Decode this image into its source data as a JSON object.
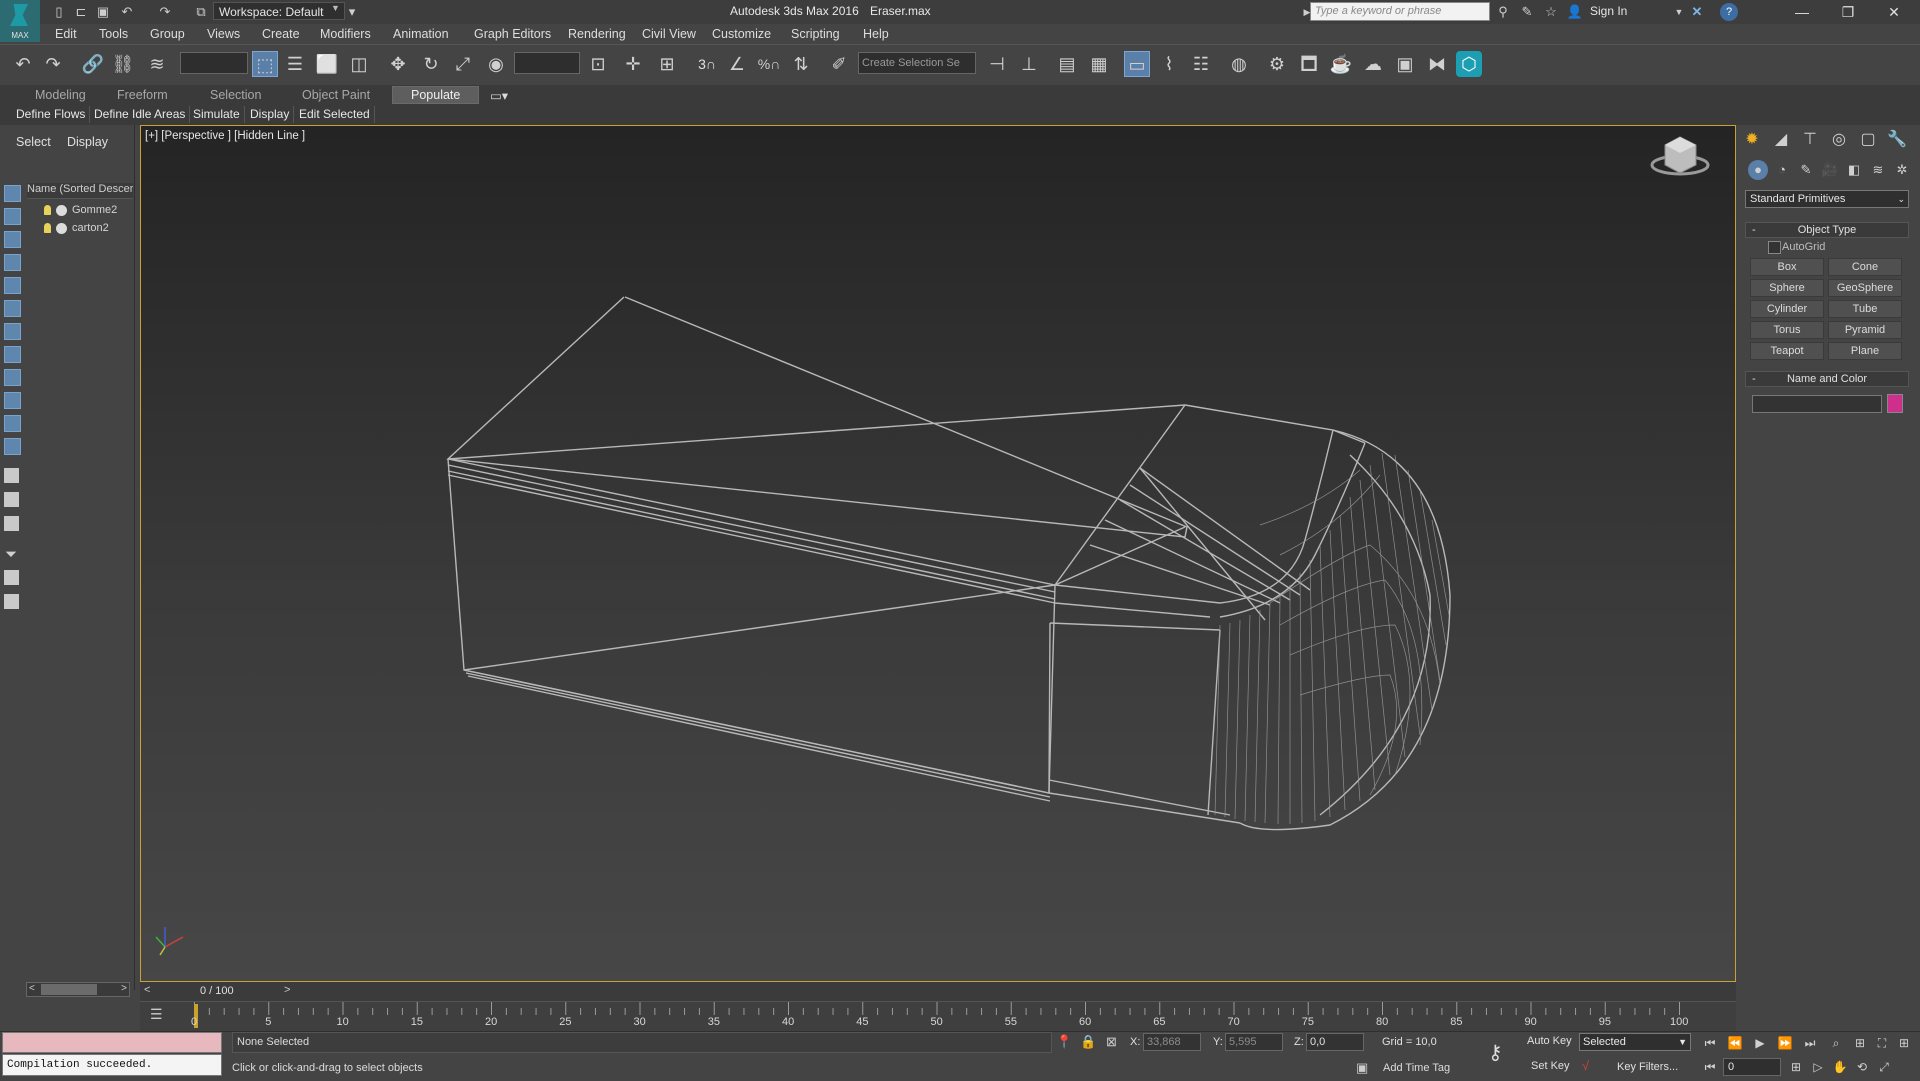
{
  "titlebar": {
    "workspace": "Workspace: Default",
    "app_title": "Autodesk 3ds Max 2016",
    "file_name": "Eraser.max",
    "search_placeholder": "Type a keyword or phrase",
    "sign_in": "Sign In",
    "logo_text": "MAX"
  },
  "menu": [
    "Edit",
    "Tools",
    "Group",
    "Views",
    "Create",
    "Modifiers",
    "Animation",
    "Graph Editors",
    "Rendering",
    "Civil View",
    "Customize",
    "Scripting",
    "Help"
  ],
  "toolbar": {
    "selection_set_placeholder": "Create Selection Se",
    "snap_label": "3",
    "percent_label": "%"
  },
  "ribbon": {
    "tabs": [
      "Modeling",
      "Freeform",
      "Selection",
      "Object Paint",
      "Populate"
    ],
    "active_tab": "Populate",
    "sub_items": [
      "Define Flows",
      "Define Idle Areas",
      "Simulate",
      "Display",
      "Edit Selected"
    ]
  },
  "explorer": {
    "tabs": [
      "Select",
      "Display"
    ],
    "column_header": "Name (Sorted Descer",
    "objects": [
      "Gomme2",
      "carton2"
    ]
  },
  "viewport": {
    "label": "[+] [Perspective ] [Hidden Line ]"
  },
  "command_panel": {
    "dropdown": "Standard Primitives",
    "object_type_title": "Object Type",
    "autogrid": "AutoGrid",
    "buttons": [
      "Box",
      "Cone",
      "Sphere",
      "GeoSphere",
      "Cylinder",
      "Tube",
      "Torus",
      "Pyramid",
      "Teapot",
      "Plane"
    ],
    "name_color_title": "Name and Color",
    "object_color": "#cc2f8c"
  },
  "timeline": {
    "slider_text": "0 / 100",
    "tick_labels": [
      "0",
      "5",
      "10",
      "15",
      "20",
      "25",
      "30",
      "35",
      "40",
      "45",
      "50",
      "55",
      "60",
      "65",
      "70",
      "75",
      "80",
      "85",
      "90",
      "95",
      "100"
    ]
  },
  "status": {
    "maxscript_output": "Compilation succeeded.",
    "selection": "None Selected",
    "prompt": "Click or click-and-drag to select objects",
    "x_label": "X:",
    "x_value": "33,868",
    "y_label": "Y:",
    "y_value": "5,595",
    "z_label": "Z:",
    "z_value": "0,0",
    "grid": "Grid = 10,0",
    "add_time_tag": "Add Time Tag",
    "auto_key": "Auto Key",
    "set_key": "Set Key",
    "selected": "Selected",
    "key_filters": "Key Filters...",
    "frame": "0"
  },
  "colors": {
    "viewport_border": "#c7a23a",
    "accent": "#5a7fa8"
  }
}
